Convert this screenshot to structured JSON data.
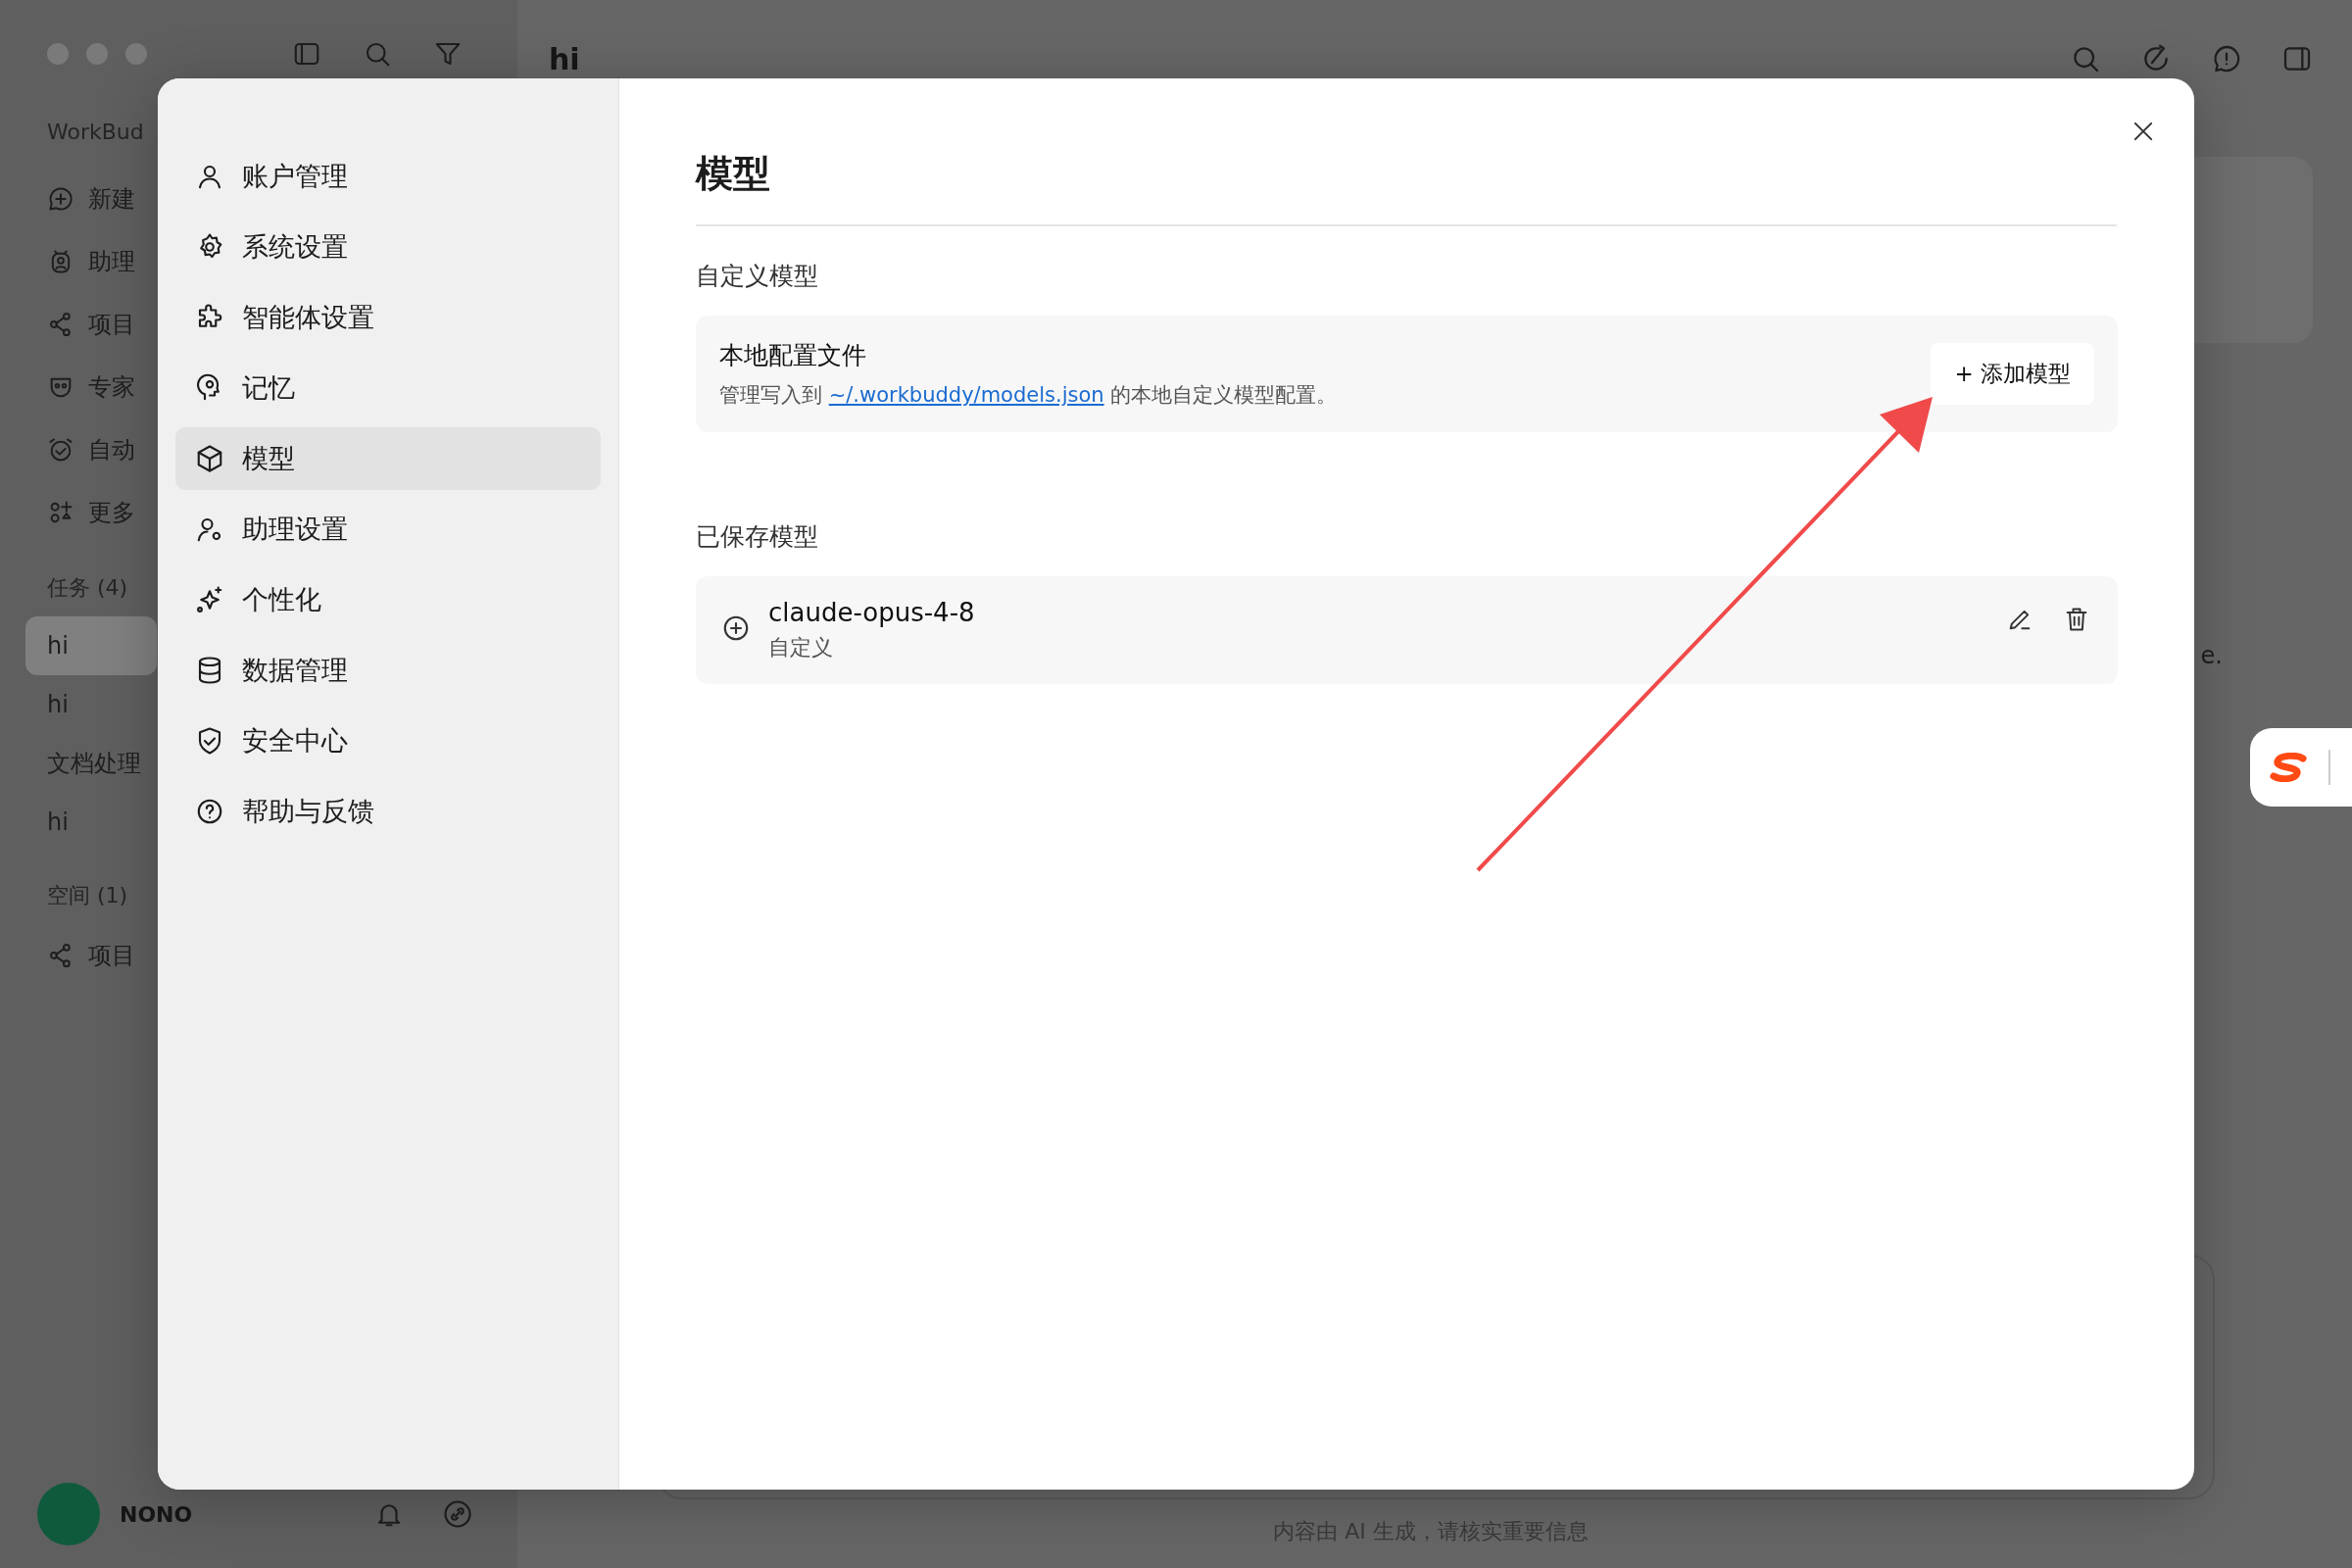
{
  "app": {
    "sidebar": {
      "brand": "WorkBud",
      "nav": [
        {
          "label": "新建"
        },
        {
          "label": "助理"
        },
        {
          "label": "项目"
        },
        {
          "label": "专家"
        },
        {
          "label": "自动"
        },
        {
          "label": "更多"
        }
      ],
      "tasks_header": "任务 (4)",
      "tasks": [
        {
          "label": "hi",
          "selected": true
        },
        {
          "label": "hi",
          "selected": false
        },
        {
          "label": "文档处理",
          "selected": false
        },
        {
          "label": "hi",
          "selected": false
        }
      ],
      "spaces_header": "空间 (1)",
      "spaces": [
        {
          "label": "项目"
        }
      ],
      "user": {
        "name": "NONO"
      }
    },
    "chat": {
      "title": "hi",
      "fragment": "e.",
      "disclaimer": "内容由 AI 生成，请核实重要信息"
    }
  },
  "settings": {
    "nav": [
      {
        "label": "账户管理",
        "selected": false
      },
      {
        "label": "系统设置",
        "selected": false
      },
      {
        "label": "智能体设置",
        "selected": false
      },
      {
        "label": "记忆",
        "selected": false
      },
      {
        "label": "模型",
        "selected": true
      },
      {
        "label": "助理设置",
        "selected": false
      },
      {
        "label": "个性化",
        "selected": false
      },
      {
        "label": "数据管理",
        "selected": false
      },
      {
        "label": "安全中心",
        "selected": false
      },
      {
        "label": "帮助与反馈",
        "selected": false
      }
    ],
    "title": "模型",
    "custom": {
      "heading": "自定义模型",
      "card_title": "本地配置文件",
      "desc_before": "管理写入到",
      "link": "~/.workbuddy/models.json",
      "desc_after": "的本地自定义模型配置。",
      "button": "+ 添加模型"
    },
    "saved": {
      "heading": "已保存模型",
      "models": [
        {
          "name": "claude-opus-4-8",
          "type": "自定义"
        }
      ]
    }
  }
}
